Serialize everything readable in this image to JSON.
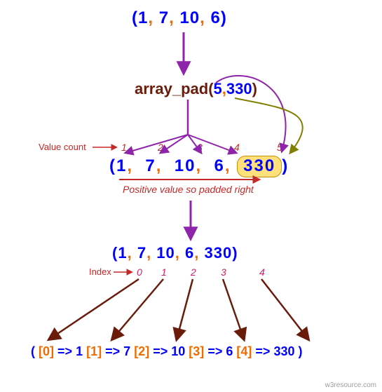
{
  "initial_array": {
    "a": "1",
    "b": "7",
    "c": "10",
    "d": "6"
  },
  "func": {
    "name": "array_pad",
    "size": "5",
    "value": "330"
  },
  "labels": {
    "value_count": "Value count",
    "positive": "Positive value so padded right",
    "index": "Index"
  },
  "counts": {
    "c1": "1",
    "c2": "2",
    "c3": "3",
    "c4": "4",
    "c5": "5"
  },
  "padded_array": {
    "a": "1",
    "b": "7",
    "c": "10",
    "d": "6",
    "e": "330"
  },
  "result_array": {
    "a": "1",
    "b": "7",
    "c": "10",
    "d": "6",
    "e": "330"
  },
  "indices": {
    "i0": "0",
    "i1": "1",
    "i2": "2",
    "i3": "3",
    "i4": "4"
  },
  "map": {
    "k0": "[0]",
    "v0": "1",
    "k1": "[1]",
    "v1": "7",
    "k2": "[2]",
    "v2": "10",
    "k3": "[3]",
    "v3": "6",
    "k4": "[4]",
    "v4": "330",
    "arrow": "=>"
  },
  "watermark": "w3resource.com"
}
